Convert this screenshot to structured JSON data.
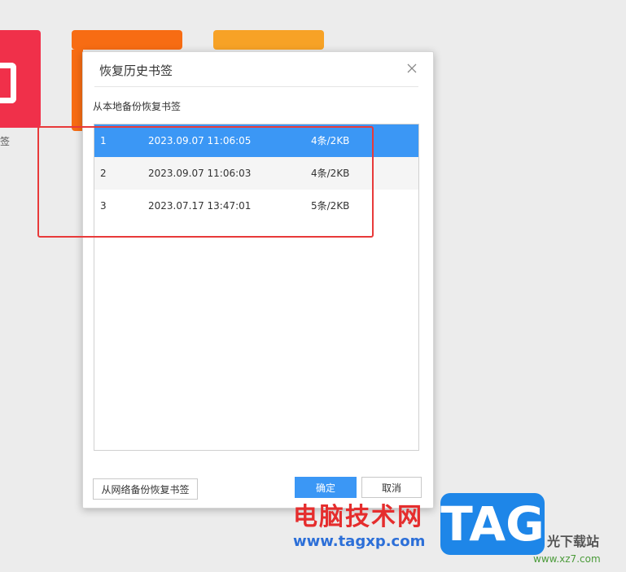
{
  "background": {
    "side_char": "签"
  },
  "dialog": {
    "title": "恢复历史书签",
    "subtitle": "从本地备份恢复书签",
    "rows": [
      {
        "index": "1",
        "time": "2023.09.07 11:06:05",
        "size": "4条/2KB",
        "selected": true
      },
      {
        "index": "2",
        "time": "2023.09.07 11:06:03",
        "size": "4条/2KB",
        "selected": false
      },
      {
        "index": "3",
        "time": "2023.07.17 13:47:01",
        "size": "5条/2KB",
        "selected": false
      }
    ],
    "network_button_label": "从网络备份恢复书签",
    "ok_button_label": "确定",
    "cancel_button_label": "取消",
    "close_icon": "close-icon"
  },
  "watermark": {
    "cn_text": "电脑技术网",
    "url": "www.tagxp.com",
    "tag": "TAG",
    "xz_text": "光下载站",
    "xz_url": "www.xz7.com"
  },
  "colors": {
    "selected_row": "#3b97f5",
    "annotation": "#e83a3a",
    "tile_red": "#f0304a",
    "tile_orange": "#f76c13",
    "tile_orange2": "#f7a226"
  }
}
